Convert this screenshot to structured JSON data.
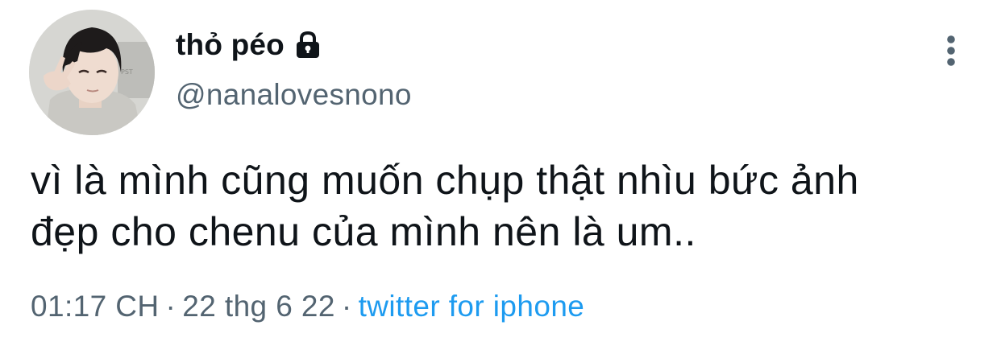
{
  "tweet": {
    "display_name": "thỏ péo",
    "handle": "@nanalovesnono",
    "text_line1": "vì là mình cũng muốn chụp thật nhìu bức ảnh",
    "text_line2": "đẹp cho chenu của mình nên là um..",
    "time": "01:17 CH",
    "separator": "·",
    "date": "22 thg 6 22",
    "source": "twitter for iphone"
  },
  "icons": {
    "lock": "lock-icon",
    "more": "more-vertical-icon",
    "avatar": "avatar-photo"
  },
  "colors": {
    "text_primary": "#0f1419",
    "text_secondary": "#536471",
    "link": "#1d9bf0"
  }
}
